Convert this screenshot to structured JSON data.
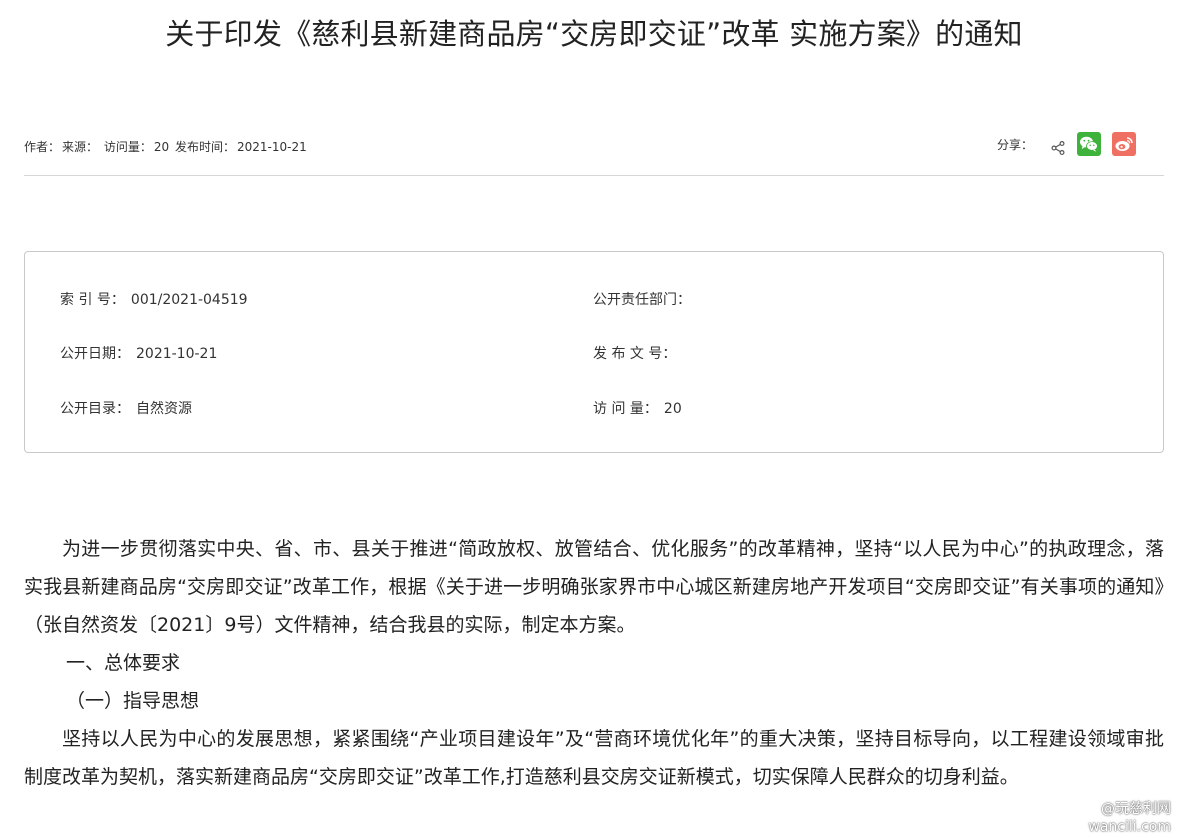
{
  "article": {
    "title": "关于印发《慈利县新建商品房“交房即交证”改革 实施方案》的通知",
    "meta": {
      "author_label": "作者：",
      "source_label": "来源：",
      "visits_label": "访问量：",
      "visits_value": "20",
      "publish_label": "发布时间：",
      "publish_value": "2021-10-21"
    },
    "share": {
      "label": "分享：",
      "icons": [
        "share-icon",
        "wechat-icon",
        "weibo-icon"
      ],
      "colors": {
        "wechat": "#3fb23c",
        "weibo": "#ef7062"
      }
    }
  },
  "info": {
    "index_label": "索 引 号：",
    "index_value": "001/2021-04519",
    "dept_label": "公开责任部门：",
    "dept_value": "",
    "date_label": "公开日期：",
    "date_value": "2021-10-21",
    "docno_label": "发 布 文 号：",
    "docno_value": "",
    "catalog_label": "公开目录：",
    "catalog_value": "自然资源",
    "visits_label": "访 问 量：",
    "visits_value": "20"
  },
  "body": {
    "para1": "为进一步贯彻落实中央、省、市、县关于推进“简政放权、放管结合、优化服务”的改革精神，坚持“以人民为中心”的执政理念，落实我县新建商品房“交房即交证”改革工作，根据《关于进一步明确张家界市中心城区新建房地产开发项目“交房即交证”有关事项的通知》（张自然资发〔2021〕9号）文件精神，结合我县的实际，制定本方案。",
    "heading1": "一、总体要求",
    "heading2": "（一）指导思想",
    "para2": "坚持以人民为中心的发展思想，紧紧围绕“产业项目建设年”及“营商环境优化年”的重大决策，坚持目标导向，以工程建设领域审批制度改革为契机，落实新建商品房“交房即交证”改革工作,打造慈利县交房交证新模式，切实保障人民群众的切身利益。"
  },
  "watermark": {
    "line1": "@玩慈利网",
    "line2": "wancili.com"
  }
}
